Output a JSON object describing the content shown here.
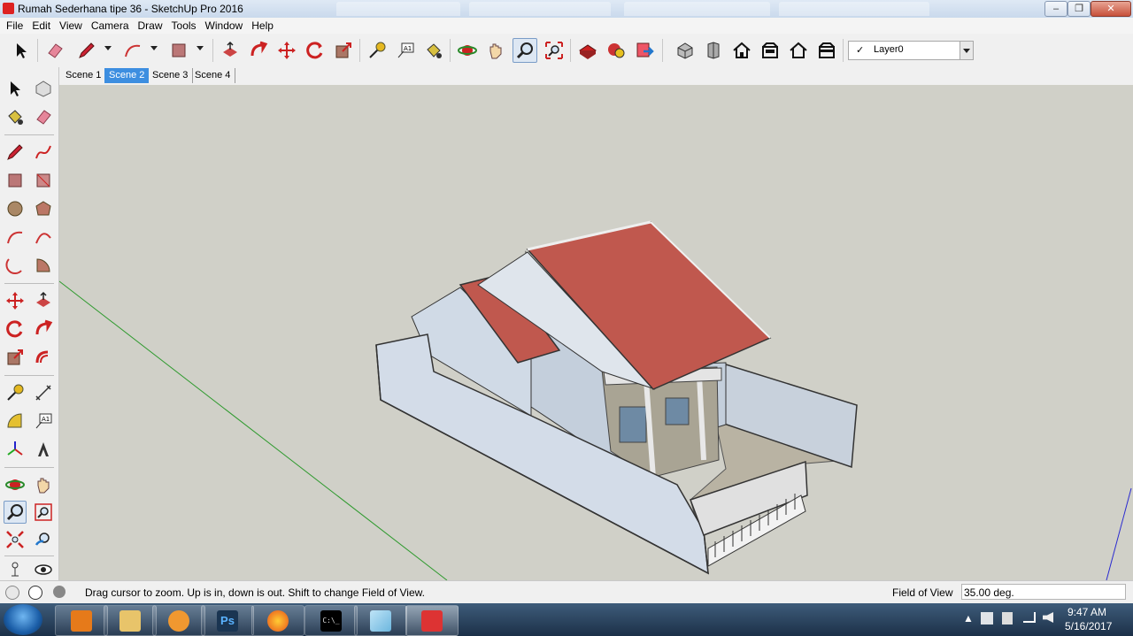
{
  "window": {
    "title": "Rumah Sederhana tipe 36 - SketchUp Pro 2016",
    "minimize_glyph": "–",
    "maximize_glyph": "❐",
    "close_glyph": "✕"
  },
  "menu": [
    "File",
    "Edit",
    "View",
    "Camera",
    "Draw",
    "Tools",
    "Window",
    "Help"
  ],
  "toolbar": {
    "icons": [
      "select-icon",
      "eraser-icon",
      "pencil-icon",
      "arc-icon",
      "rectangle-icon",
      "push-pull-icon",
      "follow-me-icon",
      "move-icon",
      "rotate-icon",
      "scale-icon",
      "tape-measure-icon",
      "text-icon",
      "paint-bucket-icon",
      "orbit-icon",
      "pan-icon",
      "zoom-icon",
      "zoom-extents-icon",
      "warehouse-icon",
      "extension-warehouse-icon",
      "send-to-layout-icon",
      "iso-view-icon",
      "top-view-icon",
      "front-view-icon",
      "right-view-icon",
      "back-view-icon",
      "left-view-icon"
    ],
    "layer": {
      "check": "✓",
      "name": "Layer0"
    }
  },
  "scenes": [
    "Scene 1",
    "Scene 2",
    "Scene 3",
    "Scene 4"
  ],
  "active_scene": "Scene 2",
  "palette": {
    "active_tool": "zoom-icon"
  },
  "status": {
    "message": "Drag cursor to zoom.  Up is in, down is out. Shift to change Field of View.",
    "fov_label": "Field of View",
    "fov_value": "35.00 deg."
  },
  "taskbar": {
    "apps": [
      "windows-explorer-icon",
      "media-player-icon",
      "file-manager-icon",
      "uc-browser-icon",
      "photoshop-icon",
      "firefox-icon",
      "command-prompt-icon",
      "notes-icon",
      "sketchup-icon"
    ],
    "photoshop_label": "Ps",
    "cmd_label": "C:\\_",
    "tray_expand": "▲",
    "time": "9:47 AM",
    "date": "5/16/2017"
  },
  "colors": {
    "roof": "#c0584e",
    "wall": "#cfd9e6",
    "sky": "#d0d0c8",
    "axis_green": "#2f9a2f",
    "axis_blue": "#2a2ad0",
    "accent": "#3d8ee0"
  }
}
